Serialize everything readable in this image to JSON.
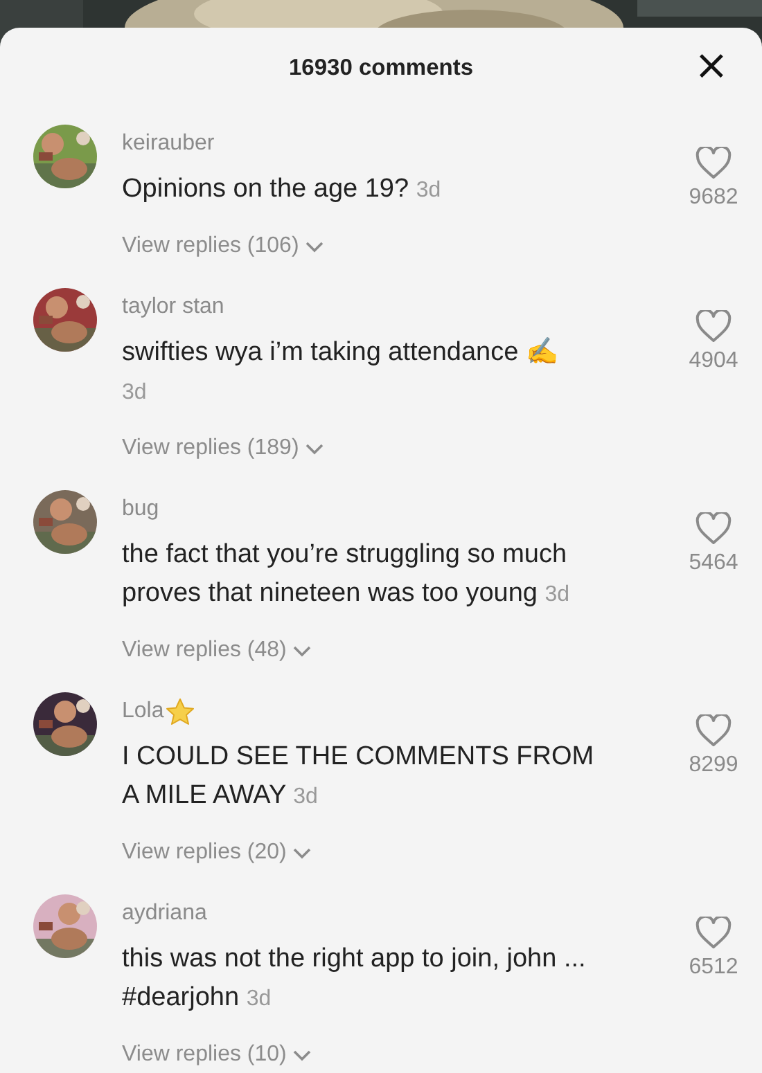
{
  "sheet": {
    "title": "16930 comments",
    "close": "×"
  },
  "comments": [
    {
      "user": "keirauber",
      "star": false,
      "lines": [
        "Opinions on the age 19?"
      ],
      "time": "3d",
      "likes": "9682",
      "replies": "View replies (106)"
    },
    {
      "user": "taylor stan",
      "star": false,
      "lines": [
        "swifties wya i’m taking attendance ✍"
      ],
      "time": "3d",
      "likes": "4904",
      "replies": "View replies (189)"
    },
    {
      "user": "bug",
      "star": false,
      "lines": [
        "the fact that you’re struggling so much",
        "proves that nineteen was too young"
      ],
      "time": "3d",
      "likes": "5464",
      "replies": "View replies (48)"
    },
    {
      "user": "Lola",
      "star": true,
      "lines": [
        "I COULD SEE THE COMMENTS FROM",
        "A MILE AWAY"
      ],
      "time": "3d",
      "likes": "8299",
      "replies": "View replies (20)"
    },
    {
      "user": "aydriana",
      "star": false,
      "lines": [
        "this was not the right app to join, john ...",
        "#dearjohn"
      ],
      "time": "3d",
      "likes": "6512",
      "replies": "View replies (10)"
    }
  ]
}
